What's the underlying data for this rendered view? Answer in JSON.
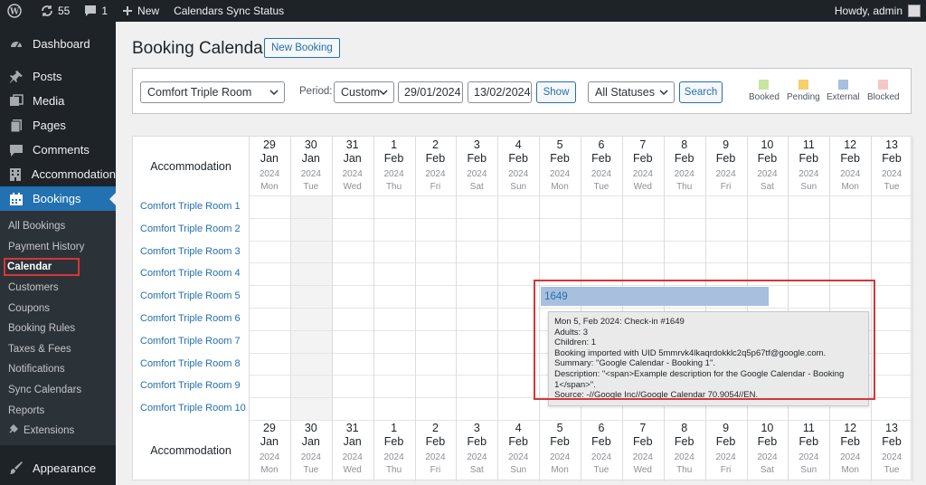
{
  "adminbar": {
    "updates_count": "55",
    "comments_count": "1",
    "new_label": "New",
    "sync_label": "Calendars Sync Status",
    "greeting": "Howdy, admin"
  },
  "sidebar": {
    "menu": [
      {
        "label": "Dashboard",
        "icon": "dashboard-icon"
      },
      {
        "label": "Posts",
        "icon": "pin-icon"
      },
      {
        "label": "Media",
        "icon": "media-icon"
      },
      {
        "label": "Pages",
        "icon": "pages-icon"
      },
      {
        "label": "Comments",
        "icon": "comment-icon"
      },
      {
        "label": "Accommodation",
        "icon": "building-icon"
      },
      {
        "label": "Bookings",
        "icon": "calendar-icon"
      }
    ],
    "submenu": [
      "All Bookings",
      "Payment History",
      "Calendar",
      "Customers",
      "Coupons",
      "Booking Rules",
      "Taxes & Fees",
      "Notifications",
      "Sync Calendars",
      "Reports",
      "Extensions"
    ],
    "appearance": "Appearance"
  },
  "page": {
    "title": "Booking Calendar",
    "new_booking": "New Booking"
  },
  "filters": {
    "room": "Comfort Triple Room",
    "period_label": "Period:",
    "period": "Custom",
    "date_from": "29/01/2024",
    "date_to": "13/02/2024",
    "show_label": "Show",
    "status": "All Statuses",
    "search_label": "Search"
  },
  "legend": [
    {
      "label": "Booked",
      "color": "#c8e6a0"
    },
    {
      "label": "Pending",
      "color": "#f5d06b"
    },
    {
      "label": "External",
      "color": "#a8bfdd"
    },
    {
      "label": "Blocked",
      "color": "#f7c6c7"
    }
  ],
  "calendar": {
    "accommodation_label": "Accommodation",
    "days": [
      {
        "day": "29",
        "month": "Jan",
        "year": "2024",
        "weekday": "Mon"
      },
      {
        "day": "30",
        "month": "Jan",
        "year": "2024",
        "weekday": "Tue"
      },
      {
        "day": "31",
        "month": "Jan",
        "year": "2024",
        "weekday": "Wed"
      },
      {
        "day": "1",
        "month": "Feb",
        "year": "2024",
        "weekday": "Thu"
      },
      {
        "day": "2",
        "month": "Feb",
        "year": "2024",
        "weekday": "Fri"
      },
      {
        "day": "3",
        "month": "Feb",
        "year": "2024",
        "weekday": "Sat"
      },
      {
        "day": "4",
        "month": "Feb",
        "year": "2024",
        "weekday": "Sun"
      },
      {
        "day": "5",
        "month": "Feb",
        "year": "2024",
        "weekday": "Mon"
      },
      {
        "day": "6",
        "month": "Feb",
        "year": "2024",
        "weekday": "Tue"
      },
      {
        "day": "7",
        "month": "Feb",
        "year": "2024",
        "weekday": "Wed"
      },
      {
        "day": "8",
        "month": "Feb",
        "year": "2024",
        "weekday": "Thu"
      },
      {
        "day": "9",
        "month": "Feb",
        "year": "2024",
        "weekday": "Fri"
      },
      {
        "day": "10",
        "month": "Feb",
        "year": "2024",
        "weekday": "Sat"
      },
      {
        "day": "11",
        "month": "Feb",
        "year": "2024",
        "weekday": "Sun"
      },
      {
        "day": "12",
        "month": "Feb",
        "year": "2024",
        "weekday": "Mon"
      },
      {
        "day": "13",
        "month": "Feb",
        "year": "2024",
        "weekday": "Tue"
      }
    ],
    "rooms": [
      "Comfort Triple Room 1",
      "Comfort Triple Room 2",
      "Comfort Triple Room 3",
      "Comfort Triple Room 4",
      "Comfort Triple Room 5",
      "Comfort Triple Room 6",
      "Comfort Triple Room 7",
      "Comfort Triple Room 8",
      "Comfort Triple Room 9",
      "Comfort Triple Room 10"
    ],
    "booking": {
      "id": "1649",
      "color": "#a8bfdd",
      "tooltip": [
        "Mon 5, Feb 2024: Check-in #1649",
        "Adults: 3",
        "Children: 1",
        "Booking imported with UID 5mmrvk4lkaqrdokklc2q5p67tf@google.com.",
        "Summary: \"Google Calendar - Booking 1\".",
        "Description: \"<span>Example description for the Google Calendar - Booking",
        "1</span>\".",
        "Source: -//Google Inc//Google Calendar 70.9054//EN."
      ]
    }
  }
}
